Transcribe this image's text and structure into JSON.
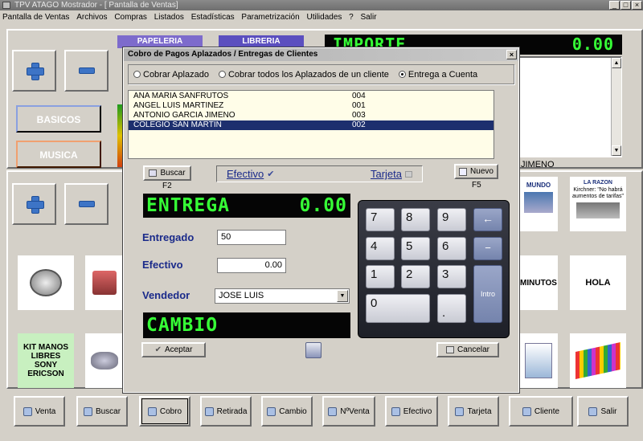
{
  "window": {
    "title": "TPV ATAGO Mostrador - [ Pantalla de Ventas]"
  },
  "menu": [
    "Pantalla de Ventas",
    "Archivos",
    "Compras",
    "Listados",
    "Estadísticas",
    "Parametrización",
    "Utilidades",
    "?",
    "Salir"
  ],
  "main": {
    "categories": [
      {
        "label": "BASICOS",
        "color": "#1537a8"
      },
      {
        "label": "MUSICA",
        "color": "#c2500c"
      }
    ],
    "category_partial": [
      "PAPELERIA",
      "LIBRERIA"
    ],
    "importe": {
      "label": "IMPORTE",
      "value": "0.00"
    },
    "client_line": "JIMENO",
    "products": [
      "MINUTOS",
      "HOLA",
      "KIT MANOS LIBRES SONY ERICSON"
    ],
    "newspaper_titles": [
      "MUNDO",
      "LA RAZON"
    ],
    "newspaper_headline": "Kirchner: \"No habrá aumentos de tarifas\""
  },
  "bottom_buttons": [
    "Venta",
    "Buscar",
    "Cobro",
    "Retirada",
    "Cambio",
    "NºVenta",
    "Efectivo",
    "Tarjeta",
    "Cliente",
    "Salir"
  ],
  "dialog": {
    "title": "Cobro de Pagos Aplazados / Entregas de Clientes",
    "close": "×",
    "radios": [
      {
        "label": "Cobrar Aplazado",
        "checked": false
      },
      {
        "label": "Cobrar todos los Aplazados de un cliente",
        "checked": false
      },
      {
        "label": "Entrega a Cuenta",
        "checked": true
      }
    ],
    "clients": [
      {
        "name": "ANA MARIA SANFRUTOS",
        "code": "004"
      },
      {
        "name": "ANGEL LUIS MARTINEZ",
        "code": "001"
      },
      {
        "name": "ANTONIO GARCIA JIMENO",
        "code": "003"
      },
      {
        "name": "COLEGIO SAN MARTIN",
        "code": "002"
      }
    ],
    "buscar": {
      "label": "Buscar",
      "shortcut": "F2"
    },
    "pay_methods": {
      "efectivo": "Efectivo",
      "tarjeta": "Tarjeta"
    },
    "nuevo": {
      "label": "Nuevo",
      "shortcut": "F5"
    },
    "entrega_display": {
      "label": "ENTREGA",
      "value": "0.00"
    },
    "entregado": {
      "label": "Entregado",
      "value": "50"
    },
    "efectivo": {
      "label": "Efectivo",
      "value": "0.00"
    },
    "vendedor": {
      "label": "Vendedor",
      "value": "JOSE LUIS"
    },
    "cambio_display": "CAMBIO",
    "keypad": {
      "rows": [
        [
          "7",
          "8",
          "9"
        ],
        [
          "4",
          "5",
          "6"
        ],
        [
          "1",
          "2",
          "3"
        ]
      ],
      "zero": "0",
      "dot": ".",
      "backspace": "←",
      "minus": "−",
      "enter": "Intro"
    },
    "aceptar": "Aceptar",
    "cancelar": "Cancelar"
  }
}
